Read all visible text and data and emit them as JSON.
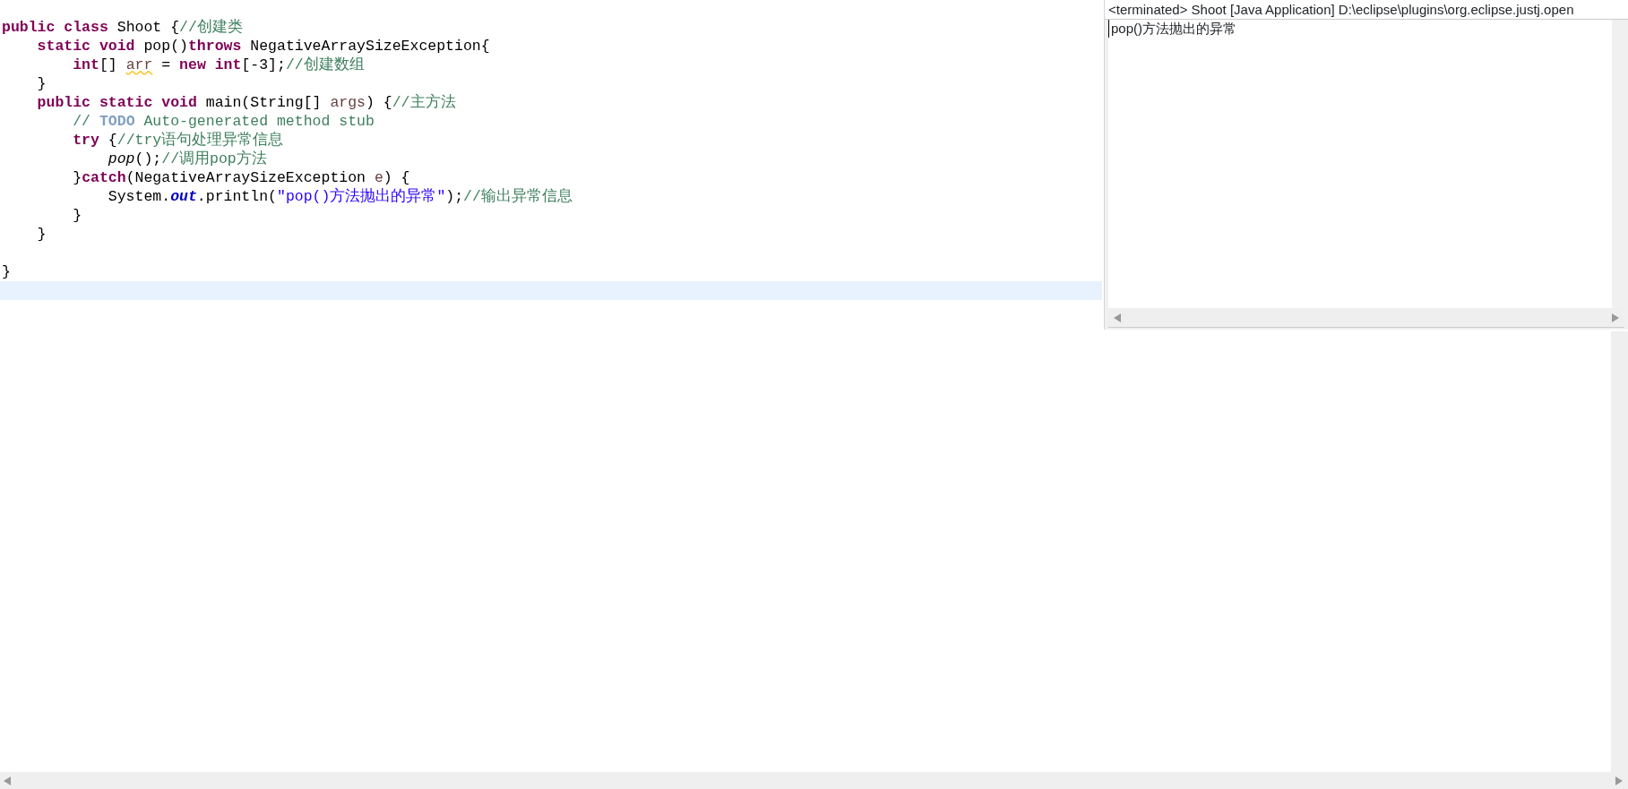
{
  "editor": {
    "lines": [
      {
        "current": false,
        "tokens": [
          {
            "kind": "keyword",
            "text": "public class"
          },
          {
            "kind": "plain",
            "text": " Shoot {"
          },
          {
            "kind": "comment",
            "text": "//创建类"
          }
        ]
      },
      {
        "current": false,
        "tokens": [
          {
            "kind": "keyword",
            "text": "    static void"
          },
          {
            "kind": "plain",
            "text": " pop()"
          },
          {
            "kind": "keyword",
            "text": "throws"
          },
          {
            "kind": "plain",
            "text": " NegativeArraySizeException{"
          }
        ]
      },
      {
        "current": false,
        "tokens": [
          {
            "kind": "keyword",
            "text": "        int"
          },
          {
            "kind": "plain",
            "text": "[] "
          },
          {
            "kind": "warning",
            "text": "arr"
          },
          {
            "kind": "plain",
            "text": " = "
          },
          {
            "kind": "keyword",
            "text": "new int"
          },
          {
            "kind": "plain",
            "text": "[-3];"
          },
          {
            "kind": "comment",
            "text": "//创建数组"
          }
        ]
      },
      {
        "current": false,
        "tokens": [
          {
            "kind": "plain",
            "text": "    }"
          }
        ]
      },
      {
        "current": false,
        "tokens": [
          {
            "kind": "keyword",
            "text": "    public static void"
          },
          {
            "kind": "plain",
            "text": " main(String[] "
          },
          {
            "kind": "variable",
            "text": "args"
          },
          {
            "kind": "plain",
            "text": ") {"
          },
          {
            "kind": "comment",
            "text": "//主方法"
          }
        ]
      },
      {
        "current": false,
        "tokens": [
          {
            "kind": "comment",
            "text": "        // "
          },
          {
            "kind": "todo",
            "text": "TODO"
          },
          {
            "kind": "comment",
            "text": " Auto-generated method stub"
          }
        ]
      },
      {
        "current": false,
        "tokens": [
          {
            "kind": "keyword",
            "text": "        try"
          },
          {
            "kind": "plain",
            "text": " {"
          },
          {
            "kind": "comment",
            "text": "//try语句处理异常信息"
          }
        ]
      },
      {
        "current": false,
        "tokens": [
          {
            "kind": "static-call",
            "text": "            pop"
          },
          {
            "kind": "plain",
            "text": "();"
          },
          {
            "kind": "comment",
            "text": "//调用pop方法"
          }
        ]
      },
      {
        "current": false,
        "tokens": [
          {
            "kind": "plain",
            "text": "        }"
          },
          {
            "kind": "keyword",
            "text": "catch"
          },
          {
            "kind": "plain",
            "text": "(NegativeArraySizeException "
          },
          {
            "kind": "variable",
            "text": "e"
          },
          {
            "kind": "plain",
            "text": ") {"
          }
        ]
      },
      {
        "current": false,
        "tokens": [
          {
            "kind": "plain",
            "text": "            System."
          },
          {
            "kind": "field",
            "text": "out"
          },
          {
            "kind": "plain",
            "text": ".println("
          },
          {
            "kind": "string",
            "text": "\"pop()方法抛出的异常\""
          },
          {
            "kind": "plain",
            "text": ");"
          },
          {
            "kind": "comment",
            "text": "//输出异常信息"
          }
        ]
      },
      {
        "current": false,
        "tokens": [
          {
            "kind": "plain",
            "text": "        }"
          }
        ]
      },
      {
        "current": false,
        "tokens": [
          {
            "kind": "plain",
            "text": "    }"
          }
        ]
      },
      {
        "current": false
      },
      {
        "current": false,
        "tokens": [
          {
            "kind": "plain",
            "text": "}"
          }
        ]
      },
      {
        "current": true
      }
    ]
  },
  "console": {
    "header": "<terminated> Shoot [Java Application] D:\\eclipse\\plugins\\org.eclipse.justj.open",
    "output": "pop()方法抛出的异常"
  }
}
